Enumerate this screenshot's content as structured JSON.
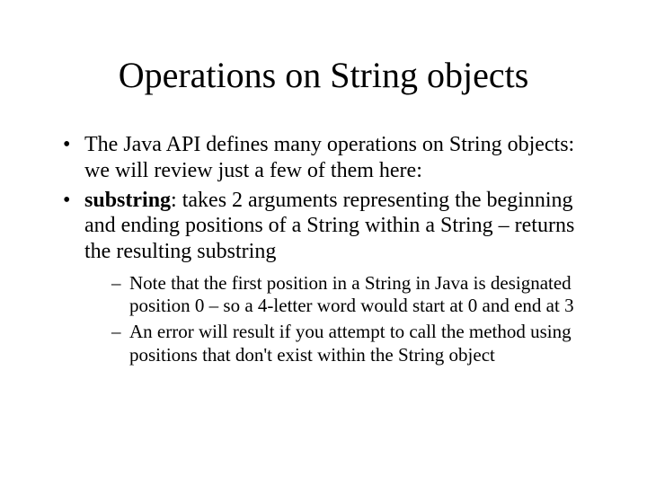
{
  "title": "Operations on String objects",
  "bullets": [
    {
      "text_plain": "The Java API defines many operations on String objects: we will review just a few of them here:"
    },
    {
      "bold_lead": "substring",
      "text_rest": ": takes 2 arguments representing the beginning and ending positions of a String within a String – returns the resulting substring",
      "sub": [
        "Note that the first position in a String in Java is designated position 0 – so a 4-letter word would start at 0 and end at 3",
        "An error will result if you attempt to call the method using positions that don't exist within the String object"
      ]
    }
  ]
}
